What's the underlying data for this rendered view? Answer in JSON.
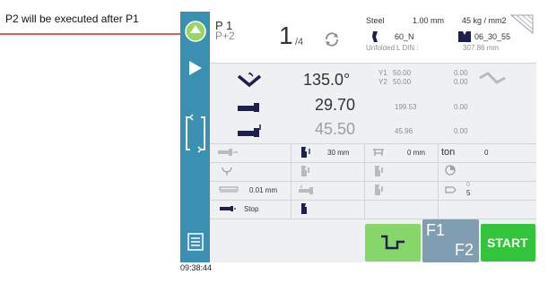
{
  "annotation": {
    "text": "P2 will be executed after P1"
  },
  "sidebar": {
    "time": "09:38:44"
  },
  "header": {
    "program_current": "P 1",
    "program_next": "P+2",
    "step_current": "1",
    "step_total": "/4",
    "material": "Steel",
    "thickness": "1.00 mm",
    "strength": "45 kg / mm2",
    "upper_tool": "60_N",
    "lower_tool": "06_30_55",
    "unfolded_label": "Unfolded",
    "length_label": "L  DIN :",
    "length_value": "307.86 mm"
  },
  "rows": {
    "angle": "135.0°",
    "y1_label": "Y1",
    "y1_value": "50.00",
    "y1_right": "0.00",
    "y2_label": "Y2",
    "y2_value": "50.00",
    "y2_right": "0.00",
    "backgauge_x": "29.70",
    "backgauge_x_mid": "199.53",
    "backgauge_x_right": "0.00",
    "backgauge_r": "45.50",
    "backgauge_r_mid": "45.96",
    "backgauge_r_right": "0.00"
  },
  "grid": {
    "r1c2": "30 mm",
    "r1c3": "0 mm",
    "r1c4_label": "ton",
    "r1c4_value": "0",
    "r3c1": "0.01 mm",
    "r3c4_top": "0",
    "r3c4_bottom": "5",
    "r4c1": "Stop"
  },
  "buttons": {
    "f1": "F1",
    "f2": "F2",
    "start": "START"
  },
  "colors": {
    "sidebar": "#3b8fb1",
    "start_green": "#33c43b",
    "light_green": "#86d66a",
    "f_button": "#7f9eb1",
    "arrow": "#e1262d"
  }
}
